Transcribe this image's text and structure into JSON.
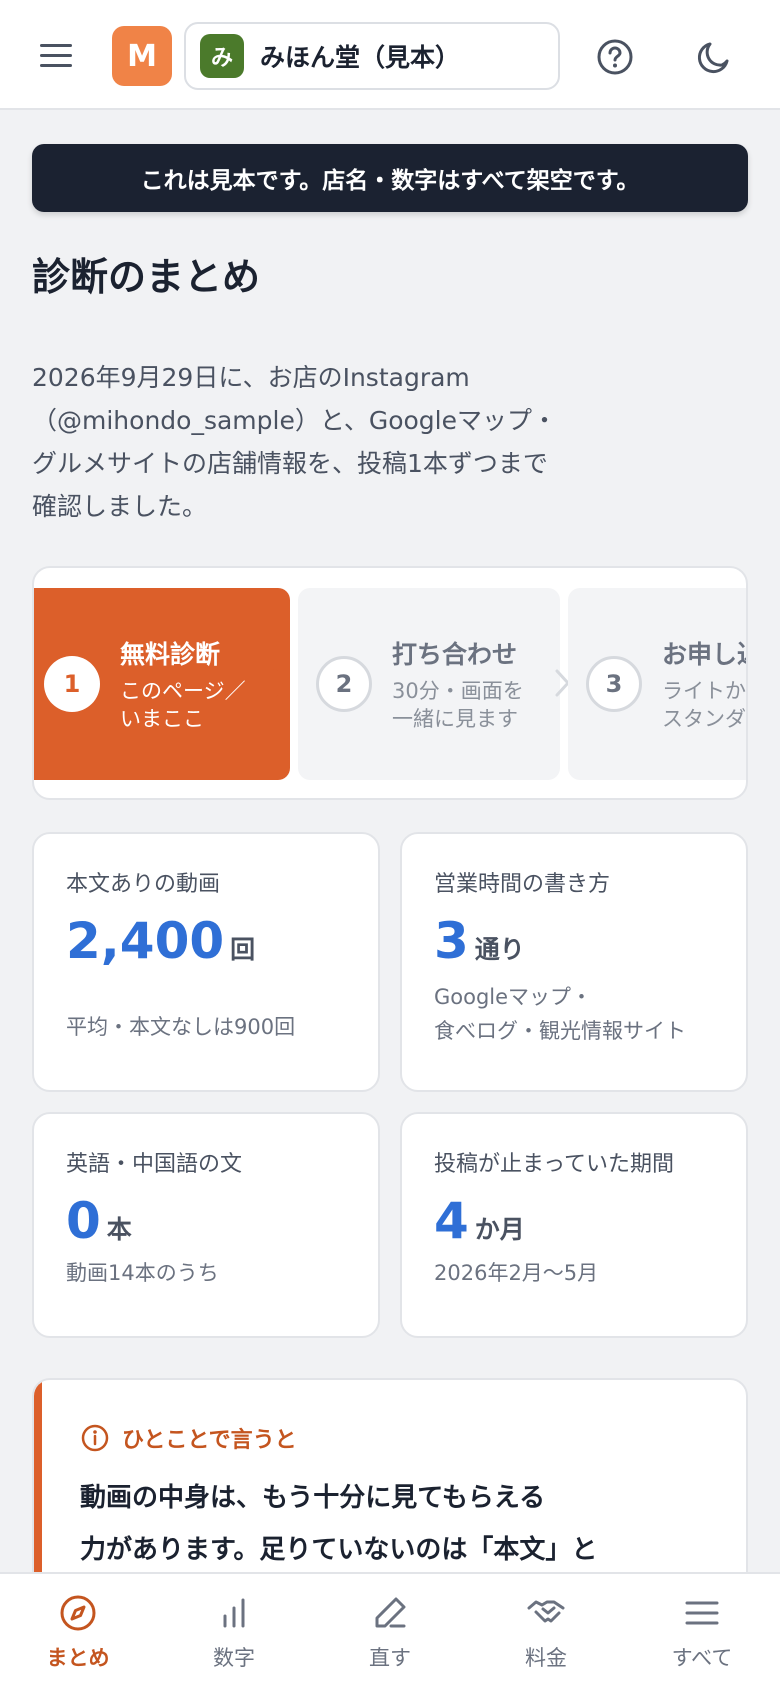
{
  "header": {
    "brand_initial": "M",
    "store_initial": "み",
    "store_name": "みほん堂（見本）"
  },
  "banner": "これは見本です。店名・数字はすべて架空です。",
  "page_title": "診断のまとめ",
  "intro_lines": [
    "2026年9月29日に、お店のInstagram",
    "（@mihondo_sample）と、Googleマップ・",
    "グルメサイトの店舗情報を、投稿1本ずつまで",
    "確認しました。"
  ],
  "steps": [
    {
      "num": "1",
      "title": "無料診断",
      "sub1": "このページ／",
      "sub2": "いまここ"
    },
    {
      "num": "2",
      "title": "打ち合わせ",
      "sub1": "30分・画面を",
      "sub2": "一緒に見ます"
    },
    {
      "num": "3",
      "title": "お申し込み",
      "sub1": "ライトか",
      "sub2": "スタンダード"
    }
  ],
  "stats": [
    {
      "label": "本文ありの動画",
      "value": "2,400",
      "unit": "回",
      "note1": "平均・本文なしは900回",
      "note2": ""
    },
    {
      "label": "営業時間の書き方",
      "value": "3",
      "unit": "通り",
      "note1": "Googleマップ・",
      "note2": "食べログ・観光情報サイト"
    },
    {
      "label": "英語・中国語の文",
      "value": "0",
      "unit": "本",
      "note1": "動画14本のうち",
      "note2": ""
    },
    {
      "label": "投稿が止まっていた期間",
      "value": "4",
      "unit": "か月",
      "note1": "2026年2月〜5月",
      "note2": ""
    }
  ],
  "summary": {
    "label": "ひとことで言うと",
    "line1": "動画の中身は、もう十分に見てもらえる",
    "line2": "力があります。足りていないのは「本文」と"
  },
  "nav": [
    {
      "label": "まとめ",
      "icon": "compass-icon"
    },
    {
      "label": "数字",
      "icon": "bar-chart-icon"
    },
    {
      "label": "直す",
      "icon": "pencil-icon"
    },
    {
      "label": "料金",
      "icon": "handshake-icon"
    },
    {
      "label": "すべて",
      "icon": "menu-icon"
    }
  ],
  "colors": {
    "accent": "#dc5f2a",
    "value_blue": "#2f6fd6",
    "banner_bg": "#1b2231",
    "brand": "#f08347",
    "store_avatar": "#4b7a2b"
  }
}
